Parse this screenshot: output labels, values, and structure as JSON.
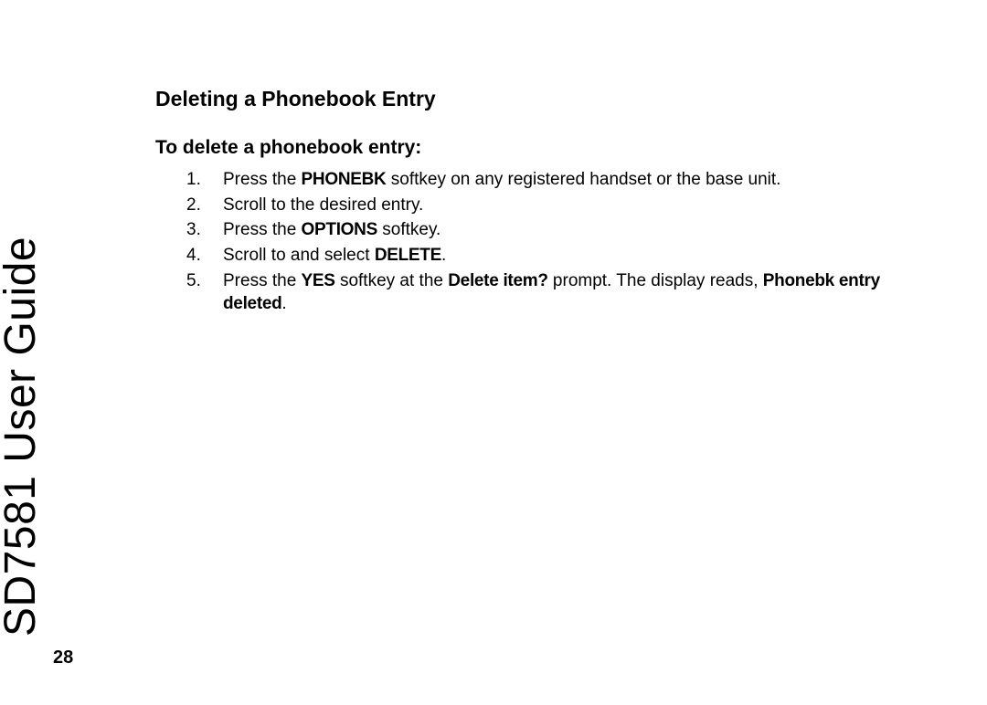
{
  "sideTitle": "SD7581 User Guide",
  "pageNumber": "28",
  "heading": "Deleting a Phonebook Entry",
  "subheading": "To delete a phonebook entry:",
  "steps": {
    "s1_a": "Press the ",
    "s1_k1": "PHONEBK",
    "s1_b": " softkey on any registered handset or the base unit.",
    "s2": "Scroll to the desired entry.",
    "s3_a": "Press the ",
    "s3_k1": "OPTIONS",
    "s3_b": " softkey.",
    "s4_a": "Scroll to and select ",
    "s4_k1": "DELETE",
    "s4_b": ".",
    "s5_a": "Press the ",
    "s5_k1": "YES",
    "s5_b": " softkey at the ",
    "s5_k2": "Delete item?",
    "s5_c": " prompt. The display reads, ",
    "s5_k3": "Phonebk entry deleted",
    "s5_d": "."
  }
}
